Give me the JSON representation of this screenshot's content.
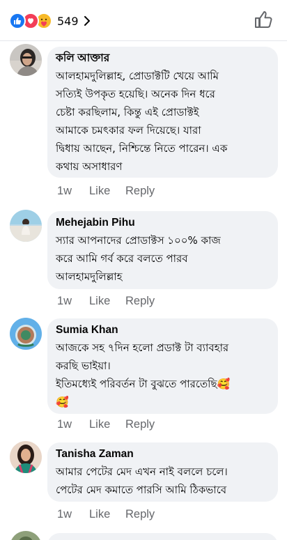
{
  "reactions": {
    "count": "549",
    "types": [
      "like-reaction-icon",
      "love-reaction-icon",
      "care-reaction-icon"
    ],
    "colors": {
      "like": "#1877f2",
      "love": "#f33e58",
      "care": "#f7b928"
    }
  },
  "comments": [
    {
      "author": "কলি আক্তার",
      "text": "আলহামদুলিল্লাহ, প্রোডাক্টটি খেয়ে আমি\nসত্যিই উপকৃত হয়েছি। অনেক দিন ধরে\nচেষ্টা করছিলাম, কিন্তু এই প্রোডাক্টই\nআমাকে চমৎকার ফল দিয়েছে। যারা\nদ্বিধায় আছেন, নিশ্চিন্তে নিতে পারেন। এক\nকথায় অসাধারণ",
      "time": "1w",
      "like": "Like",
      "reply": "Reply"
    },
    {
      "author": "Mehejabin Pihu",
      "text": "স্যার আপনাদের প্রোডাক্টস ১০০% কাজ\nকরে আমি গর্ব করে বলতে পারব\nআলহামদুলিল্লাহ",
      "time": "1w",
      "like": "Like",
      "reply": "Reply"
    },
    {
      "author": "Sumia Khan",
      "text": "আজকে সহ ৭দিন হলো প্রডাক্ট টা ব্যাবহার\nকরছি ভাইয়া।\nইতিমধ্যেই পরিবর্তন টা বুঝতে পারতেছি🥰\n🥰",
      "time": "1w",
      "like": "Like",
      "reply": "Reply"
    },
    {
      "author": "Tanisha Zaman",
      "text": "আমার পেটের মেদ এখন নাই বললে চলে।\nপেটের মেদ কমাতে পারসি আমি ঠিকভাবে",
      "time": "1w",
      "like": "Like",
      "reply": "Reply"
    }
  ]
}
